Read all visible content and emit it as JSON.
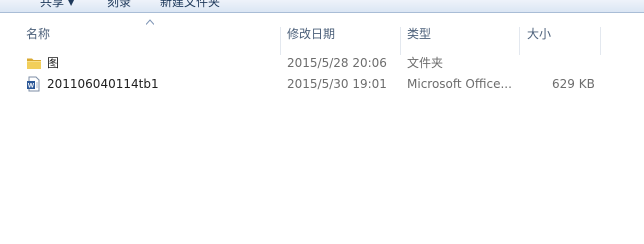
{
  "toolbar": {
    "share_label": "共享",
    "burn_label": "刻录",
    "new_folder_label": "新建文件夹"
  },
  "columns": {
    "name": "名称",
    "modified": "修改日期",
    "type": "类型",
    "size": "大小"
  },
  "files": [
    {
      "name": "图",
      "modified": "2015/5/28 20:06",
      "type": "文件夹",
      "size": "",
      "icon": "folder-icon"
    },
    {
      "name": "201106040114tb1",
      "modified": "2015/5/30 19:01",
      "type": "Microsoft Office...",
      "size": "629 KB",
      "icon": "word-document-icon"
    }
  ],
  "colors": {
    "header_text": "#4c607a",
    "toolbar_text": "#1e395b",
    "folder": "#e8c255",
    "word_blue": "#2b5797"
  }
}
